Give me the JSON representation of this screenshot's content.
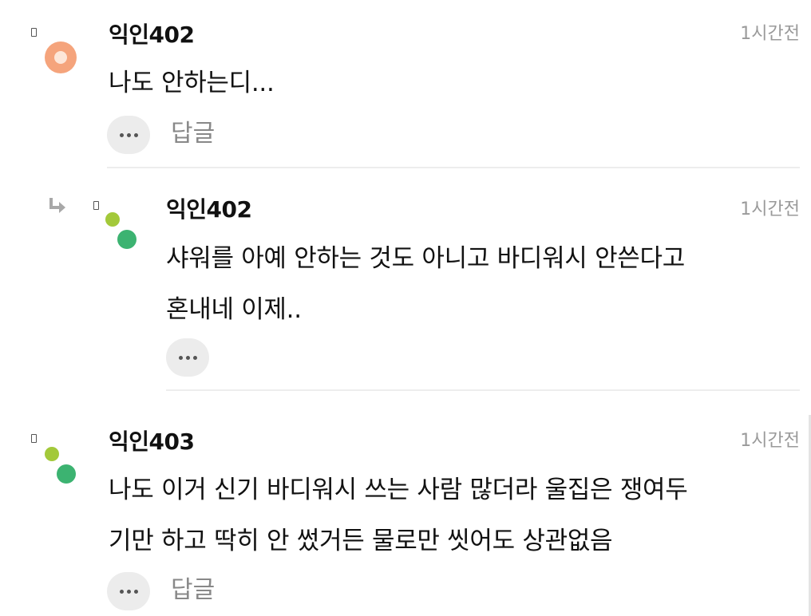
{
  "comments": [
    {
      "author": "익인402",
      "time": "1시간전",
      "lines": [
        "나도 안하는디..."
      ],
      "reply_label": "답글"
    },
    {
      "author": "익인402",
      "time": "1시간전",
      "lines": [
        "샤워를 아예 안하는 것도 아니고 바디워시 안쓴다고",
        "혼내네 이제.."
      ]
    },
    {
      "author": "익인403",
      "time": "1시간전",
      "lines": [
        "나도 이거 신기 바디워시 쓰는 사람 많더라 울집은 쟁여두",
        "기만 하고 딱히 안 썼거든 물로만 씻어도 상관없음"
      ],
      "reply_label": "답글"
    }
  ],
  "colors": {
    "avatar_orange": "#f5a47c",
    "avatar_green_light": "#a3c93a",
    "avatar_green": "#3cb371",
    "time_gray": "#9a9a9a",
    "button_bg": "#ececec"
  },
  "icons": {
    "more": "more-horizontal-icon",
    "reply": "reply-arrow-icon"
  }
}
